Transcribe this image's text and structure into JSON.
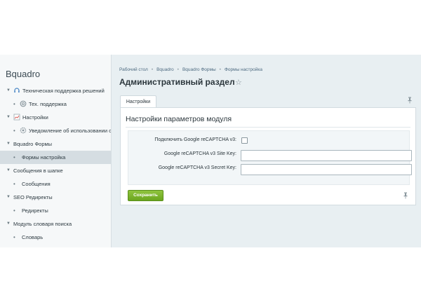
{
  "sidebar": {
    "brand": "Bquadro",
    "items": [
      {
        "label": "Техническая поддержка решений"
      },
      {
        "label": "Тех. поддержка"
      },
      {
        "label": "Настройки"
      },
      {
        "label": "Уведомление об использовании cook"
      },
      {
        "label": "Bquadro Формы"
      },
      {
        "label": "Формы настройка"
      },
      {
        "label": "Сообщения в шапке"
      },
      {
        "label": "Сообщения"
      },
      {
        "label": "SEO Редиректы"
      },
      {
        "label": "Редиректы"
      },
      {
        "label": "Модуль словаря поиска"
      },
      {
        "label": "Словарь"
      }
    ]
  },
  "breadcrumb": {
    "items": [
      "Рабочий стол",
      "Bquadro",
      "Bquadro Формы",
      "Формы настройка"
    ],
    "separator": "•"
  },
  "page": {
    "title": "Административный раздел"
  },
  "tab": {
    "label": "Настройки"
  },
  "panel": {
    "title": "Настройки параметров модуля",
    "fields": {
      "recaptcha_enable_label": "Подключить Google reCAPTCHA v3:",
      "site_key_label": "Google reCAPTCHA v3 Site Key:",
      "site_key_value": "",
      "secret_key_label": "Google reCAPTCHA v3 Secret Key:",
      "secret_key_value": ""
    },
    "save_label": "Сохранить"
  },
  "colors": {
    "accent_green": "#6aa51f",
    "link_blue": "#4d6a80",
    "background": "#e8eff2"
  }
}
